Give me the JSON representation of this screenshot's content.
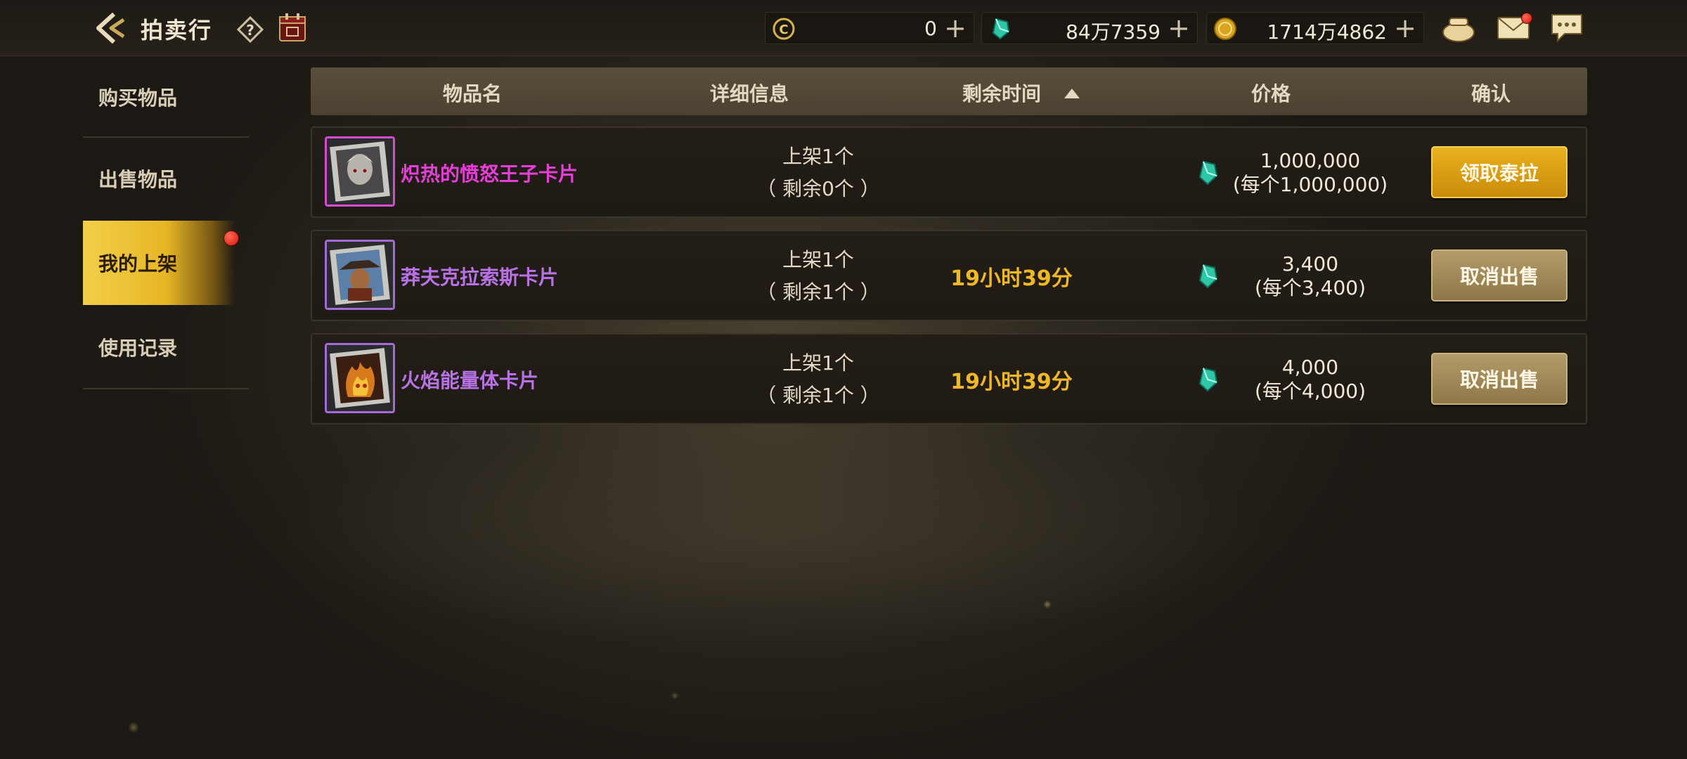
{
  "header": {
    "title": "拍卖行",
    "currencies": [
      {
        "icon": "c-coin-icon",
        "value": "0",
        "plus": "+"
      },
      {
        "icon": "tera-gem-icon",
        "value": "84万7359",
        "plus": "+"
      },
      {
        "icon": "gold-coin-icon",
        "value": "1714万4862",
        "plus": "+"
      }
    ],
    "icons": [
      "back-arrow-icon",
      "help-icon",
      "calendar-icon",
      "purse-icon",
      "mail-icon",
      "chat-icon"
    ]
  },
  "sidebar": {
    "items": [
      {
        "label": "购买物品",
        "active": false
      },
      {
        "label": "出售物品",
        "active": false
      },
      {
        "label": "我的上架",
        "active": true
      },
      {
        "label": "使用记录",
        "active": false
      }
    ]
  },
  "table": {
    "headers": {
      "name": "物品名",
      "detail": "详细信息",
      "time": "剩余时间",
      "price": "价格",
      "confirm": "确认"
    },
    "rows": [
      {
        "name": "炽热的愤怒王子卡片",
        "name_color": "#e53fd6",
        "listed": "上架1个",
        "remaining": "（ 剩余0个 ）",
        "time": "",
        "price": "1,000,000",
        "unit_price": "(每个1,000,000)",
        "button": "领取泰拉",
        "button_style": "gold"
      },
      {
        "name": "莽夫克拉索斯卡片",
        "name_color": "#b872e6",
        "listed": "上架1个",
        "remaining": "（ 剩余1个 ）",
        "time": "19小时39分",
        "price": "3,400",
        "unit_price": "(每个3,400)",
        "button": "取消出售",
        "button_style": "tan"
      },
      {
        "name": "火焰能量体卡片",
        "name_color": "#b872e6",
        "listed": "上架1个",
        "remaining": "（ 剩余1个 ）",
        "time": "19小时39分",
        "price": "4,000",
        "unit_price": "(每个4,000)",
        "button": "取消出售",
        "button_style": "tan"
      }
    ]
  }
}
